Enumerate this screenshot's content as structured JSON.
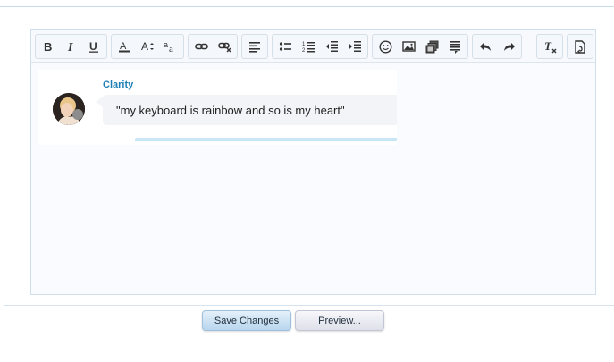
{
  "toolbar": {
    "groups": [
      {
        "name": "text-style",
        "buttons": [
          "bold-icon",
          "italic-icon",
          "underline-icon"
        ]
      },
      {
        "name": "font",
        "buttons": [
          "text-color-icon",
          "font-size-icon",
          "font-family-icon"
        ]
      },
      {
        "name": "links",
        "buttons": [
          "link-icon",
          "unlink-icon"
        ]
      },
      {
        "name": "align",
        "buttons": [
          "align-left-icon"
        ]
      },
      {
        "name": "lists",
        "buttons": [
          "bullet-list-icon",
          "numbered-list-icon",
          "outdent-icon",
          "indent-icon"
        ]
      },
      {
        "name": "insert",
        "buttons": [
          "smiley-icon",
          "image-icon",
          "media-icon",
          "quote-icon"
        ]
      },
      {
        "name": "history",
        "buttons": [
          "undo-icon",
          "redo-icon"
        ]
      },
      {
        "name": "format",
        "buttons": [
          "remove-format-icon"
        ]
      },
      {
        "name": "source",
        "buttons": [
          "toggle-source-icon"
        ]
      }
    ]
  },
  "quote": {
    "author": "Clarity",
    "text": "\"my keyboard is rainbow and so is my heart\""
  },
  "actions": {
    "save_label": "Save Changes",
    "preview_label": "Preview..."
  },
  "colors": {
    "author_link": "#1f7fb5",
    "save_button": "#b9d6ee",
    "quote_strip": "#c9e6f6"
  }
}
